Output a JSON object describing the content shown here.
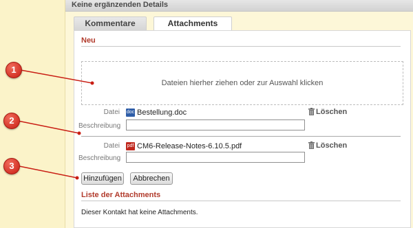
{
  "header": {
    "title": "Keine ergänzenden Details"
  },
  "tabs": [
    {
      "label": "Kommentare"
    },
    {
      "label": "Attachments"
    }
  ],
  "new_section": {
    "title": "Neu"
  },
  "dropzone": {
    "text": "Dateien hierher ziehen oder zur Auswahl klicken"
  },
  "files": [
    {
      "file_label": "Datei",
      "icon": "doc",
      "icon_name": "word-doc-icon",
      "name": "Bestellung.doc",
      "delete_label": "Löschen",
      "desc_label": "Beschreibung",
      "desc_value": ""
    },
    {
      "file_label": "Datei",
      "icon": "pdf",
      "icon_name": "pdf-file-icon",
      "name": "CM6-Release-Notes-6.10.5.pdf",
      "delete_label": "Löschen",
      "desc_label": "Beschreibung",
      "desc_value": ""
    }
  ],
  "buttons": {
    "add": "Hinzufügen",
    "cancel": "Abbrechen"
  },
  "list_section": {
    "title": "Liste der Attachments",
    "empty": "Dieser Kontakt hat keine Attachments."
  },
  "markers": [
    {
      "label": "1"
    },
    {
      "label": "2"
    },
    {
      "label": "3"
    }
  ],
  "colors": {
    "accent": "#b13a2b",
    "marker": "#d2291d",
    "background": "#fbf3c9"
  }
}
